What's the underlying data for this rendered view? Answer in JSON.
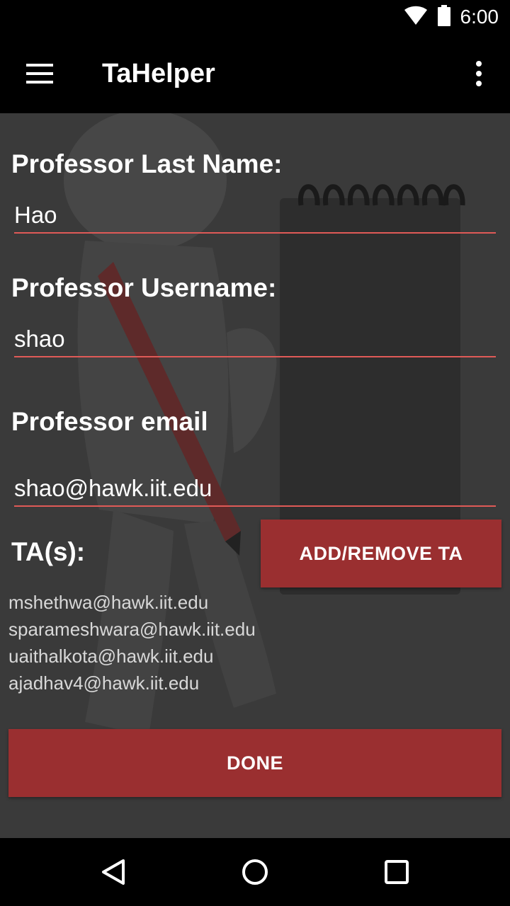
{
  "status_bar": {
    "time": "6:00",
    "icons": [
      "wifi-icon",
      "battery-icon"
    ]
  },
  "app_bar": {
    "title": "TaHelper",
    "menu_icon": "hamburger-menu-icon",
    "overflow_icon": "more-vert-icon"
  },
  "form": {
    "last_name_label": "Professor Last Name:",
    "last_name_value": "Hao",
    "username_label": "Professor Username:",
    "username_value": "shao",
    "email_label": "Professor email",
    "email_value": "shao@hawk.iit.edu",
    "tas_label": "TA(s):",
    "add_remove_label": "ADD/REMOVE TA",
    "tas": [
      "mshethwa@hawk.iit.edu",
      "sparameshwara@hawk.iit.edu",
      "uaithalkota@hawk.iit.edu",
      "ajadhav4@hawk.iit.edu"
    ],
    "done_label": "DONE"
  },
  "nav_bar": {
    "icons": [
      "back-icon",
      "home-icon",
      "recents-icon"
    ]
  },
  "colors": {
    "accent": "#e05a57",
    "button": "#9a2f30",
    "background": "#3a3a3a"
  }
}
